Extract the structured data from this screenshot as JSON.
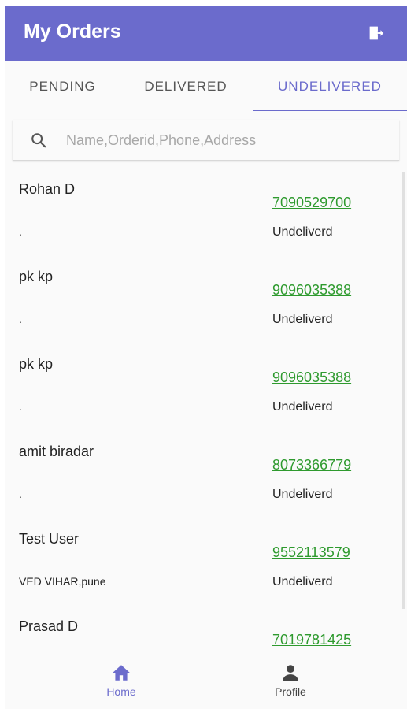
{
  "header": {
    "title": "My Orders",
    "logout_icon": "logout-icon"
  },
  "tabs": [
    {
      "label": "PENDING",
      "active": false
    },
    {
      "label": "DELIVERED",
      "active": false
    },
    {
      "label": "UNDELIVERED",
      "active": true
    }
  ],
  "search": {
    "placeholder": "Name,Orderid,Phone,Address",
    "value": "",
    "icon": "search-icon"
  },
  "orders": [
    {
      "name": "Rohan D",
      "address": ".",
      "phone": "7090529700",
      "status": "Undeliverd"
    },
    {
      "name": "pk kp",
      "address": ".",
      "phone": "9096035388",
      "status": "Undeliverd"
    },
    {
      "name": "pk kp",
      "address": ".",
      "phone": "9096035388",
      "status": "Undeliverd"
    },
    {
      "name": "amit biradar",
      "address": ".",
      "phone": "8073366779",
      "status": "Undeliverd"
    },
    {
      "name": "Test User",
      "address": "VED VIHAR,pune",
      "phone": "9552113579",
      "status": "Undeliverd"
    },
    {
      "name": "Prasad D",
      "address": "",
      "phone": "7019781425",
      "status": ""
    }
  ],
  "bottom_nav": [
    {
      "label": "Home",
      "icon": "home-icon",
      "active": true
    },
    {
      "label": "Profile",
      "icon": "person-icon",
      "active": false
    }
  ],
  "colors": {
    "primary": "#6b6bcc",
    "phone_link": "#2e9a2e",
    "background": "#fafafa"
  }
}
